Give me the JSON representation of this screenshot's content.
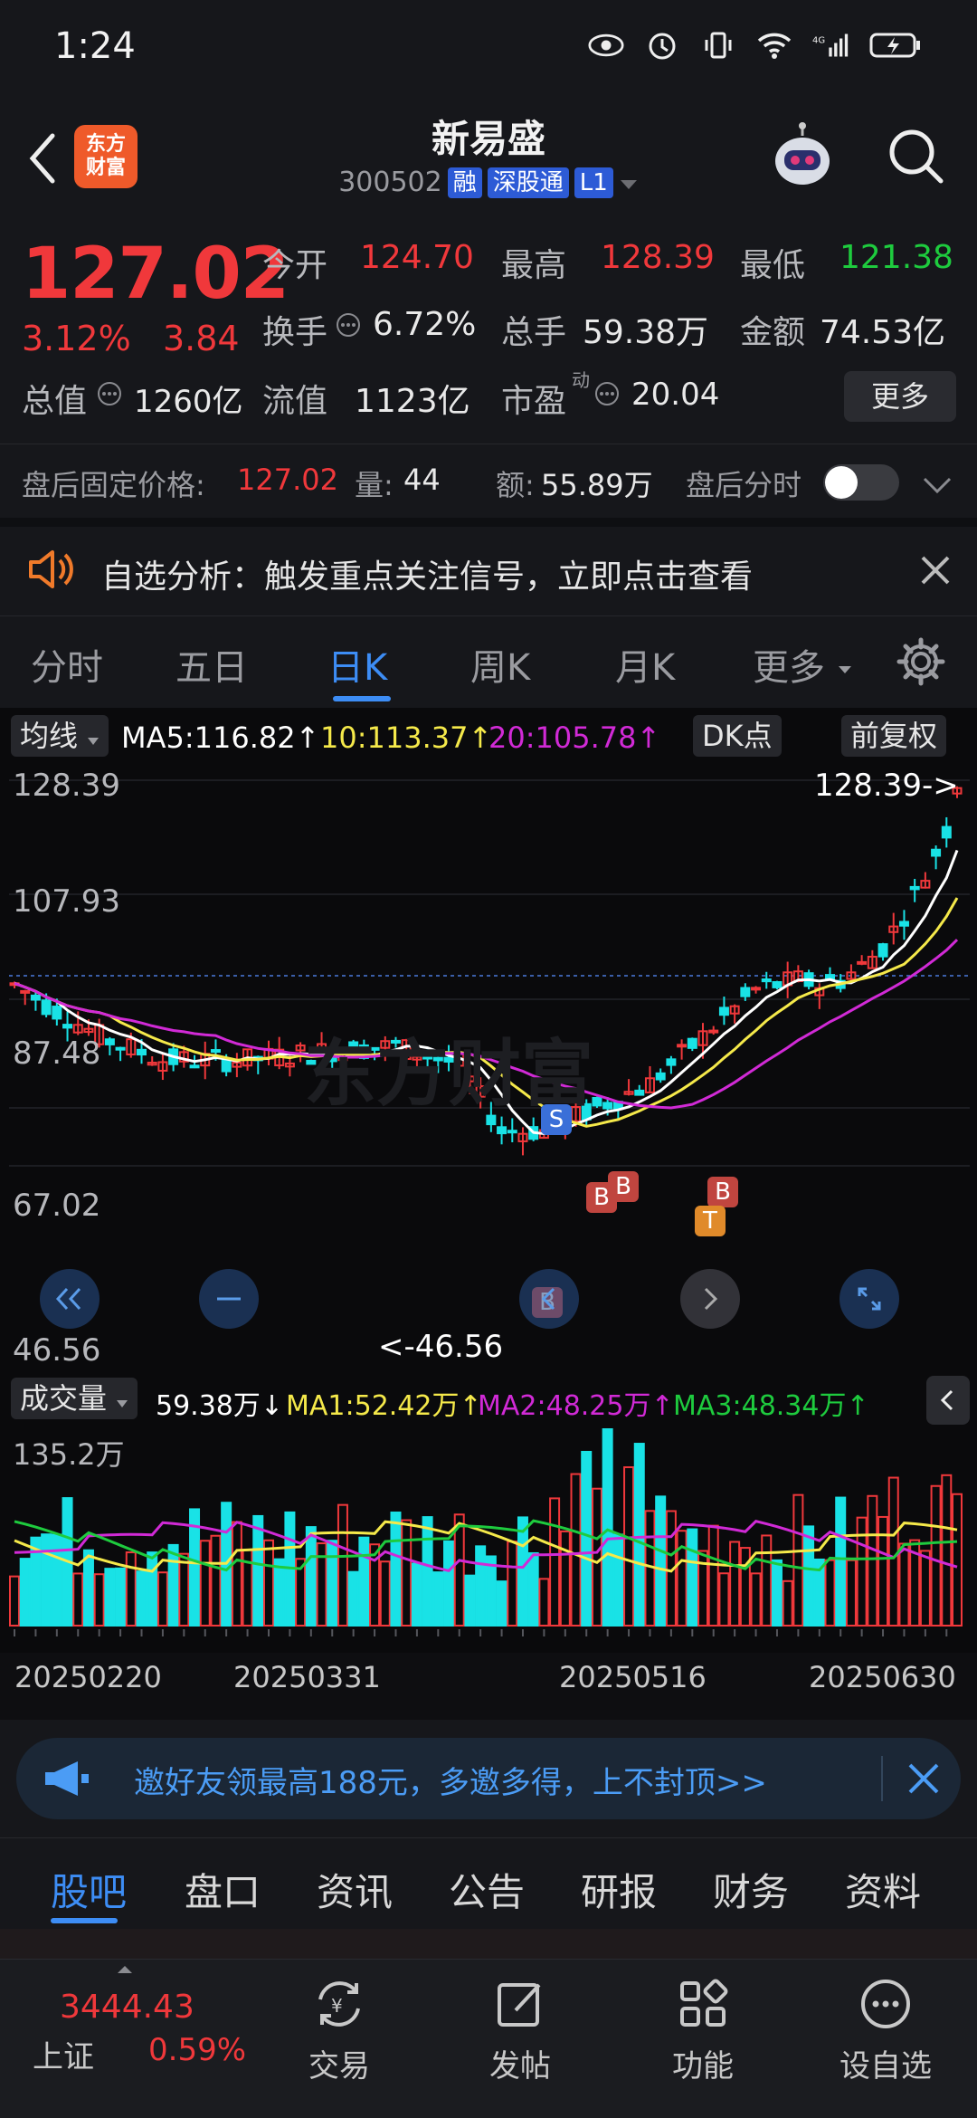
{
  "status_bar": {
    "time": "1:24",
    "network": "4G"
  },
  "header": {
    "logo_text_line1": "东方",
    "logo_text_line2": "财富",
    "stock_name": "新易盛",
    "stock_code": "300502",
    "tags": [
      "融",
      "深股通",
      "L1"
    ]
  },
  "quote": {
    "price": "127.02",
    "pct": "3.12%",
    "change": "3.84",
    "open_label": "今开",
    "open": "124.70",
    "high_label": "最高",
    "high": "128.39",
    "low_label": "最低",
    "low": "121.38",
    "turnover_label": "换手",
    "turnover": "6.72%",
    "volume_label": "总手",
    "volume": "59.38万",
    "amount_label": "金额",
    "amount": "74.53亿",
    "mktcap_label": "总值",
    "mktcap": "1260亿",
    "float_label": "流值",
    "float": "1123亿",
    "pe_label": "市盈",
    "pe_sup": "动",
    "pe": "20.04",
    "more": "更多"
  },
  "after_hours": {
    "label": "盘后固定价格:",
    "price": "127.02",
    "vol_label": "量:",
    "vol": "44",
    "amt_label": "额:",
    "amt": "55.89万",
    "toggle_label": "盘后分时"
  },
  "notice": {
    "text": "自选分析：触发重点关注信号，立即点击查看"
  },
  "chart_tabs": [
    "分时",
    "五日",
    "日K",
    "周K",
    "月K",
    "更多"
  ],
  "chart_tabs_active": 2,
  "ma_bar": {
    "label": "均线",
    "ma5": "MA5:116.82↑",
    "ma10": "10:113.37↑",
    "ma20": "20:105.78↑",
    "dk": "DK点",
    "adjust": "前复权"
  },
  "price_axis": [
    "128.39",
    "107.93",
    "87.48",
    "67.02",
    "46.56"
  ],
  "max_marker": "128.39->",
  "min_marker": "<-46.56",
  "watermark": "东方财富",
  "signals": [
    "S",
    "B",
    "B",
    "B",
    "B",
    "T"
  ],
  "volume_bar": {
    "label": "成交量",
    "vol": "59.38万↓",
    "ma1": "MA1:52.42万↑",
    "ma2": "MA2:48.25万↑",
    "ma3": "MA3:48.34万↑",
    "axis_top": "135.2万"
  },
  "date_axis": [
    "20250220",
    "20250331",
    "20250516",
    "20250630"
  ],
  "colors": {
    "up": "#f0383b",
    "down": "#19e2e6",
    "ma5": "#ffffff",
    "ma10": "#f5e94a",
    "ma20": "#d12ad6",
    "accent": "#3d8df5"
  },
  "invite": {
    "text": "邀好友领最高188元，多邀多得，上不封顶>>"
  },
  "bottom_tabs": [
    "股吧",
    "盘口",
    "资讯",
    "公告",
    "研报",
    "财务",
    "资料"
  ],
  "bottom_tabs_active": 0,
  "nav": {
    "index_value": "3444.43",
    "index_name": "上证",
    "index_pct": "0.59%",
    "items": [
      "交易",
      "发帖",
      "功能",
      "设自选"
    ]
  }
}
